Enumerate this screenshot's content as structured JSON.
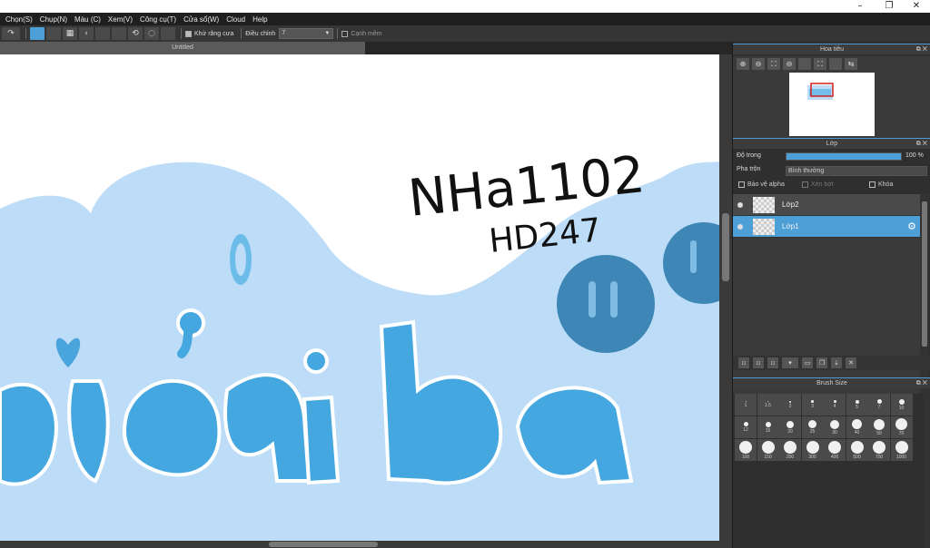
{
  "window": {
    "minimize_icon": "–",
    "maximize_icon": "❐",
    "close_icon": "✕"
  },
  "menu": [
    "Chọn(S)",
    "Chụp(N)",
    "Màu (C)",
    "Xem(V)",
    "Công cụ(T)",
    "Cửa sổ(W)",
    "Cloud",
    "Help"
  ],
  "toolbar": {
    "antialias_label": "Khử răng cưa",
    "adjust_label": "Điều chỉnh",
    "adjust_value": "7",
    "smooth_label": "Cạnh mềm"
  },
  "document": {
    "tab_title": "Untitled"
  },
  "navigator": {
    "title": "Hoa tiêu"
  },
  "layers": {
    "title": "Lớp",
    "opacity_label": "Độ trong",
    "opacity_value": "100 %",
    "opacity_fraction": 1.0,
    "blend_label": "Pha trộn",
    "blend_value": "Bình thường",
    "protect_alpha_label": "Bảo vệ alpha",
    "clip_label": "Xén bớt",
    "lock_label": "Khóa",
    "items": [
      {
        "name": "Lớp2",
        "selected": false
      },
      {
        "name": "Lớp1",
        "selected": true
      }
    ]
  },
  "brush": {
    "title": "Brush Size",
    "sizes": [
      "1",
      "1.5",
      "2",
      "3",
      "4",
      "5",
      "7",
      "10",
      "12",
      "15",
      "20",
      "25",
      "30",
      "40",
      "50",
      "70",
      "100",
      "150",
      "200",
      "300",
      "400",
      "500",
      "700",
      "1000"
    ]
  },
  "canvas_text": {
    "line1": "NHa1102",
    "line2": "HD247",
    "big_word": "giải ba"
  },
  "colors": {
    "accent": "#4d9fd8",
    "cloud": "#bcdcf7",
    "letters": "#45a7e0",
    "circle": "#3d86b6"
  }
}
